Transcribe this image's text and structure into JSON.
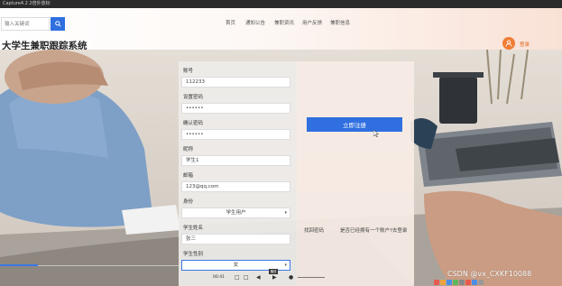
{
  "window": {
    "caption": "Capture4.2 2倍外放标"
  },
  "header": {
    "search_placeholder": "输入关键词",
    "nav": [
      "首页",
      "通知公告",
      "兼职资讯",
      "用户反馈",
      "兼职信息"
    ],
    "site_title": "大学生兼职跟踪系统",
    "login": "登录"
  },
  "form": {
    "fields": [
      {
        "label": "账号",
        "value": "112233"
      },
      {
        "label": "设置密码",
        "value": "••••••"
      },
      {
        "label": "确认密码",
        "value": "••••••"
      },
      {
        "label": "昵称",
        "value": "学生1"
      },
      {
        "label": "邮箱",
        "value": "123@qq.com"
      },
      {
        "label": "身份",
        "value": "学生用户"
      },
      {
        "label": "学生姓名",
        "value": "张三"
      },
      {
        "label": "学生性别",
        "value": "女"
      }
    ],
    "register_button": "立即注册",
    "forgot_password": "找回密码",
    "have_account": "是否已经拥有一个账户?去登录"
  },
  "player": {
    "time": "00:41",
    "tooltip": "播放"
  },
  "watermark": "CSDN @vx_CXKF10088",
  "colors": {
    "accent": "#2f6fe0",
    "login_orange": "#f07c34"
  }
}
